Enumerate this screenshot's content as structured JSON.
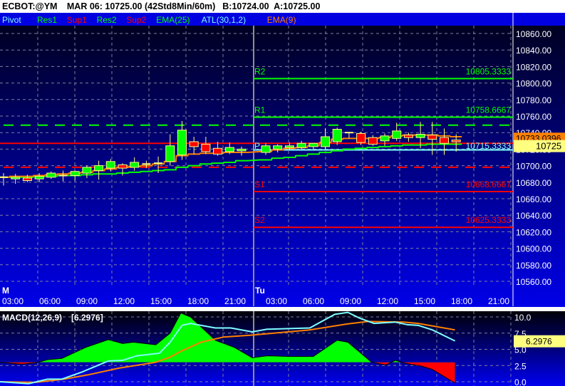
{
  "header": {
    "symbol": "ECBOT:@YM",
    "quote": "MAR 06: 10725.00 (42Std8Min/60m)",
    "bid": "B:10724.00",
    "ask": "A:10725.00"
  },
  "legend": [
    {
      "label": "Pivot",
      "color": "#80ffff"
    },
    {
      "label": "Res1",
      "color": "#00ff00"
    },
    {
      "label": "Sup1",
      "color": "#ff0000"
    },
    {
      "label": "Res2",
      "color": "#00ff00"
    },
    {
      "label": "Sup2",
      "color": "#ff0000"
    },
    {
      "label": "EMA(25)",
      "color": "#00ff00"
    },
    {
      "label": "ATL(30,1,2)",
      "color": "#80ffff"
    },
    {
      "label": "EMA(9)",
      "color": "#ff8000"
    }
  ],
  "price_axis": {
    "min": 10560,
    "max": 10860,
    "step": 20,
    "labels": [
      "10560.00",
      "10580.00",
      "10600.00",
      "10620.00",
      "10640.00",
      "10660.00",
      "10680.00",
      "10700.00",
      "10720.00",
      "10740.00",
      "10760.00",
      "10780.00",
      "10800.00",
      "10820.00",
      "10840.00",
      "10860.00"
    ]
  },
  "time_axis": {
    "day_labels": [
      "M",
      "Tu"
    ],
    "day1": [
      "03:00",
      "06:00",
      "09:00",
      "12:00",
      "15:00",
      "18:00",
      "21:00"
    ],
    "day2": [
      "03:00",
      "06:00",
      "09:00",
      "12:00",
      "15:00",
      "18:00",
      "21:00"
    ]
  },
  "pivots": [
    {
      "name": "R2",
      "value": 10805.3333,
      "label": "10805.3333",
      "color": "#00ff00"
    },
    {
      "name": "R1",
      "value": 10758.6667,
      "label": "10758.6667",
      "color": "#00ff00"
    },
    {
      "name": "P",
      "value": 10715.3333,
      "label": "10715.3333",
      "color": "#80ffff"
    },
    {
      "name": "S1",
      "value": 10668.6667,
      "label": "10668.6667",
      "color": "#ff0000"
    },
    {
      "name": "S2",
      "value": 10625.3333,
      "label": "10625.3333",
      "color": "#ff0000"
    }
  ],
  "levels": {
    "prior_res_dashed": 10749,
    "prior_sup_dashed": 10698,
    "red_solid": 10727,
    "atl": 10719
  },
  "last_price": {
    "label": "10725",
    "value": 10725
  },
  "ema9_price": {
    "label": "10733.0396",
    "value": 10733.04
  },
  "candles": [
    [
      10686,
      10691,
      10676,
      10686
    ],
    [
      10684,
      10690,
      10678,
      10686
    ],
    [
      10685,
      10689,
      10680,
      10682
    ],
    [
      10684,
      10691,
      10680,
      10687
    ],
    [
      10686,
      10693,
      10684,
      10691
    ],
    [
      10688,
      10694,
      10681,
      10688
    ],
    [
      10688,
      10694,
      10682,
      10693
    ],
    [
      10691,
      10700,
      10685,
      10698
    ],
    [
      10694,
      10706,
      10683,
      10700
    ],
    [
      10697,
      10708,
      10693,
      10705
    ],
    [
      10701,
      10703,
      10688,
      10697
    ],
    [
      10698,
      10710,
      10694,
      10704
    ],
    [
      10702,
      10706,
      10697,
      10702
    ],
    [
      10702,
      10711,
      10691,
      10703
    ],
    [
      10705,
      10738,
      10700,
      10724
    ],
    [
      10713,
      10754,
      10707,
      10743
    ],
    [
      10729,
      10735,
      10714,
      10723
    ],
    [
      10726,
      10735,
      10714,
      10717
    ],
    [
      10721,
      10729,
      10712,
      10714
    ],
    [
      10717,
      10728,
      10714,
      10722
    ],
    [
      10718,
      10723,
      10712,
      10720
    ],
    [
      10716,
      10727,
      10713,
      10724
    ],
    [
      10720,
      10726,
      10716,
      10724
    ],
    [
      10722,
      10728,
      10719,
      10724
    ],
    [
      10722,
      10730,
      10720,
      10727
    ],
    [
      10723,
      10727,
      10720,
      10727
    ],
    [
      10723,
      10745,
      10720,
      10735
    ],
    [
      10729,
      10746,
      10725,
      10744
    ],
    [
      10740,
      10738,
      10733,
      10740
    ],
    [
      10739,
      10741,
      10725,
      10728
    ],
    [
      10734,
      10737,
      10724,
      10726
    ],
    [
      10730,
      10739,
      10724,
      10736
    ],
    [
      10733,
      10752,
      10730,
      10742
    ],
    [
      10737,
      10740,
      10729,
      10734
    ],
    [
      10734,
      10753,
      10721,
      10738
    ],
    [
      10737,
      10753,
      10713,
      10732
    ],
    [
      10734,
      10745,
      10713,
      10727
    ],
    [
      10731,
      10738,
      10717,
      10729
    ]
  ],
  "ema9": [
    10686,
    10687,
    10687,
    10688,
    10689,
    10690,
    10691,
    10692,
    10694,
    10696,
    10698,
    10699,
    10700,
    10702,
    10705,
    10712,
    10714,
    10715,
    10715,
    10716,
    10716,
    10717,
    10719,
    10721,
    10722,
    10724,
    10728,
    10732,
    10733,
    10733,
    10733,
    10734,
    10736,
    10737,
    10737,
    10737,
    10736,
    10735
  ],
  "ema25": [
    10686,
    10686,
    10686,
    10687,
    10687,
    10688,
    10688,
    10689,
    10690,
    10690,
    10691,
    10692,
    10693,
    10694,
    10695,
    10698,
    10700,
    10702,
    10703,
    10704,
    10706,
    10707,
    10709,
    10710,
    10712,
    10714,
    10716,
    10718,
    10720,
    10721,
    10722,
    10723,
    10724,
    10725,
    10725,
    10726,
    10726,
    10726
  ],
  "macd_panel": {
    "title": "MACD(12,26,9)",
    "value_label": "[6.2976]",
    "current": {
      "label": "6.2976",
      "value": 6.2976
    },
    "axis": {
      "min": 0,
      "max": 10,
      "labels": [
        "0.0",
        "2.5",
        "5.0",
        "7.5",
        "10.0"
      ]
    },
    "macd_line": [
      [
        -0.3,
        0
      ],
      [
        2.1,
        -0.3
      ],
      [
        3.7,
        0.4
      ],
      [
        4.9,
        0.4
      ],
      [
        6.6,
        1.5
      ],
      [
        8.8,
        3.2
      ],
      [
        10,
        3.3
      ],
      [
        11.2,
        4.0
      ],
      [
        13.1,
        4.4
      ],
      [
        14,
        6.1
      ],
      [
        15,
        8.7
      ],
      [
        15.7,
        9.0
      ],
      [
        17.8,
        8.3
      ],
      [
        19.1,
        8.3
      ],
      [
        20.9,
        7.7
      ],
      [
        21.1,
        8.1
      ],
      [
        24.7,
        8.3
      ],
      [
        26.8,
        10.4
      ],
      [
        27.9,
        10.7
      ],
      [
        28.9,
        9.8
      ],
      [
        30.1,
        9.0
      ],
      [
        31.9,
        9.2
      ],
      [
        32.9,
        8.8
      ],
      [
        33.8,
        8.7
      ],
      [
        35,
        8.0
      ],
      [
        36.9,
        6.3
      ]
    ],
    "signal_line": [
      [
        -0.3,
        0
      ],
      [
        2.7,
        -0.1
      ],
      [
        5.1,
        0.4
      ],
      [
        7.2,
        1.1
      ],
      [
        9.7,
        2.1
      ],
      [
        12.8,
        3.0
      ],
      [
        14,
        3.8
      ],
      [
        14.9,
        4.7
      ],
      [
        16.6,
        6.1
      ],
      [
        18.5,
        6.9
      ],
      [
        20.9,
        7.2
      ],
      [
        21.7,
        7.5
      ],
      [
        24.7,
        8.0
      ],
      [
        27.8,
        8.9
      ],
      [
        29.6,
        9.3
      ],
      [
        32.6,
        9.2
      ],
      [
        33.8,
        9.0
      ],
      [
        36.9,
        8.0
      ]
    ],
    "histogram_zero": 3.0,
    "histogram": [
      [
        -0.3,
        3.0
      ],
      [
        1.5,
        2.7
      ],
      [
        2.7,
        2.9
      ],
      [
        3.7,
        3.4
      ],
      [
        4.9,
        3.6
      ],
      [
        6.9,
        5.3
      ],
      [
        8.8,
        6.5
      ],
      [
        10,
        5.9
      ],
      [
        10.9,
        6.1
      ],
      [
        12.8,
        5.7
      ],
      [
        14,
        7.5
      ],
      [
        14.9,
        10.6
      ],
      [
        15.7,
        10.0
      ],
      [
        17.8,
        6.4
      ],
      [
        19.4,
        5.3
      ],
      [
        20.9,
        3.7
      ],
      [
        21.1,
        4.0
      ],
      [
        22.9,
        3.9
      ],
      [
        25,
        3.9
      ],
      [
        27,
        6.4
      ],
      [
        27.9,
        6.1
      ],
      [
        29.9,
        3.0
      ],
      [
        31.1,
        2.6
      ],
      [
        31.9,
        3.3
      ],
      [
        32.6,
        2.9
      ],
      [
        34.1,
        2.4
      ],
      [
        35,
        1.9
      ],
      [
        36.9,
        -0.2
      ],
      [
        36.9,
        3.0
      ]
    ]
  },
  "colors": {
    "up": "#00ff00",
    "down": "#ff0000",
    "wick": "#ffff80",
    "ema9": "#ff8000",
    "ema25": "#00ff00",
    "macd": "#80ffff",
    "signal": "#ff8000"
  }
}
